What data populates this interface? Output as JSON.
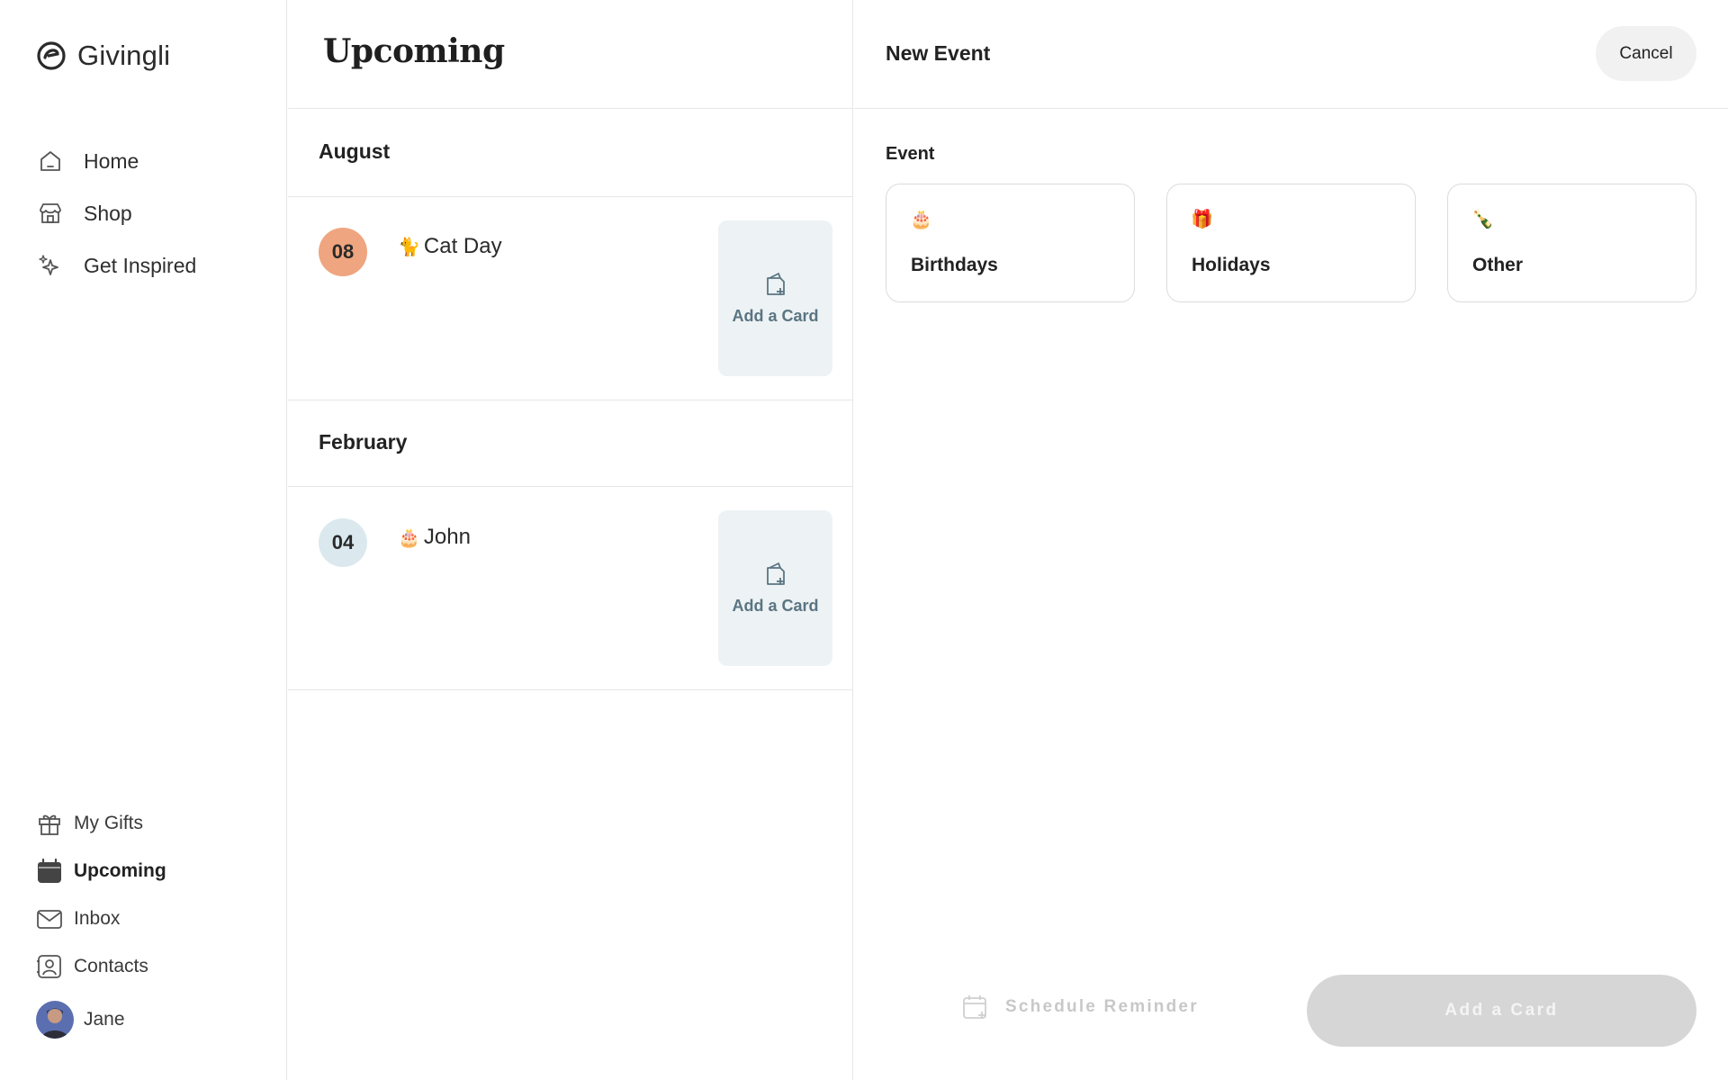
{
  "app": {
    "name": "Givingli"
  },
  "sidebar": {
    "top_items": [
      {
        "label": "Home",
        "icon": "home-icon"
      },
      {
        "label": "Shop",
        "icon": "shop-icon"
      },
      {
        "label": "Get Inspired",
        "icon": "sparkle-icon"
      }
    ],
    "bottom_items": [
      {
        "label": "My Gifts",
        "icon": "gift-icon"
      },
      {
        "label": "Upcoming",
        "icon": "calendar-icon",
        "active": true
      },
      {
        "label": "Inbox",
        "icon": "mail-icon"
      },
      {
        "label": "Contacts",
        "icon": "contact-card-icon"
      }
    ],
    "user": {
      "name": "Jane"
    }
  },
  "upcoming": {
    "title": "Upcoming",
    "groups": [
      {
        "month": "August",
        "events": [
          {
            "day": "08",
            "emoji": "🐈",
            "name": "Cat Day",
            "badge_color": "#efa57f",
            "action_label": "Add a Card"
          }
        ]
      },
      {
        "month": "February",
        "events": [
          {
            "day": "04",
            "emoji": "🎂",
            "name": "John",
            "badge_color": "#dbe9ef",
            "action_label": "Add a Card"
          }
        ]
      }
    ]
  },
  "new_event": {
    "title": "New Event",
    "cancel_label": "Cancel",
    "section_label": "Event",
    "options": [
      {
        "emoji": "🎂",
        "label": "Birthdays"
      },
      {
        "emoji": "🎁",
        "label": "Holidays"
      },
      {
        "emoji": "🍾",
        "label": "Other"
      }
    ],
    "schedule_label": "Schedule Reminder",
    "primary_label": "Add a Card"
  },
  "colors": {
    "accent_orange": "#efa57f",
    "accent_blue": "#dbe9ef",
    "tile_bg": "#edf2f4",
    "tile_text": "#5a7582",
    "disabled_btn": "#d6d6d6"
  }
}
